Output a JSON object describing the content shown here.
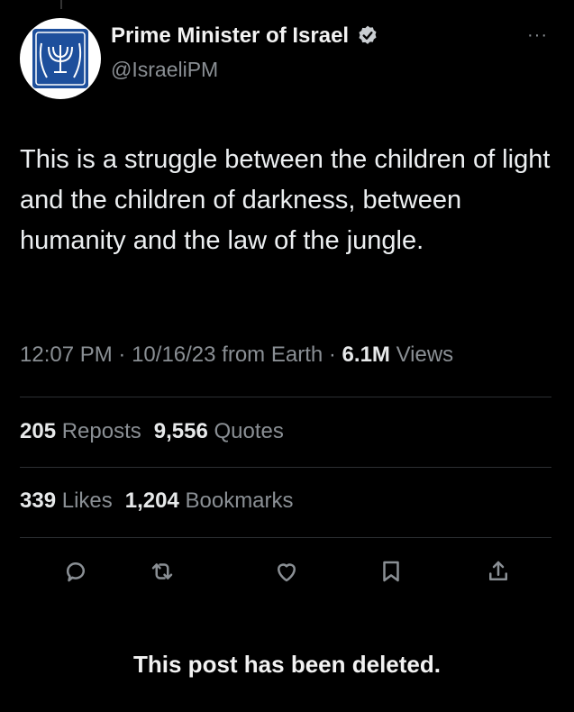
{
  "author": {
    "name": "Prime Minister of Israel",
    "handle": "@IsraeliPM"
  },
  "tweet": {
    "text": "This is a struggle between the children of light and the children of darkness, between humanity and the law of the jungle.",
    "time": "12:07 PM",
    "date": "10/16/23",
    "source": "from Earth",
    "views_count": "6.1M",
    "views_label": "Views"
  },
  "stats": {
    "reposts_count": "205",
    "reposts_label": "Reposts",
    "quotes_count": "9,556",
    "quotes_label": "Quotes",
    "likes_count": "339",
    "likes_label": "Likes",
    "bookmarks_count": "1,204",
    "bookmarks_label": "Bookmarks"
  },
  "icons": [
    "reply-icon",
    "repost-icon",
    "like-icon",
    "bookmark-icon",
    "share-icon",
    "verified-icon",
    "more-icon"
  ],
  "colors": {
    "background": "#000000",
    "muted": "#8a8f94",
    "verified": "#c9cdd1"
  },
  "notice": "This post has been deleted."
}
